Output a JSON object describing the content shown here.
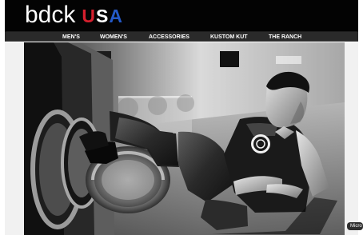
{
  "header": {
    "logo_main": "bdck",
    "logo_usa": {
      "u": "U",
      "s": "S",
      "a": "A"
    },
    "colors": {
      "background": "#030303",
      "logo_text": "#ffffff",
      "u": "#d51f2d",
      "s": "#ffffff",
      "a": "#2459c7"
    }
  },
  "nav": {
    "items": [
      {
        "label": "MEN'S"
      },
      {
        "label": "WOMEN'S"
      },
      {
        "label": "ACCESSORIES"
      },
      {
        "label": "KUSTOM KUT"
      },
      {
        "label": "THE RANCH"
      }
    ],
    "colors": {
      "background": "#2a2a2a",
      "text": "#ffffff"
    }
  },
  "hero": {
    "icon": "hero-photo"
  },
  "badge": {
    "label": "Micro"
  }
}
